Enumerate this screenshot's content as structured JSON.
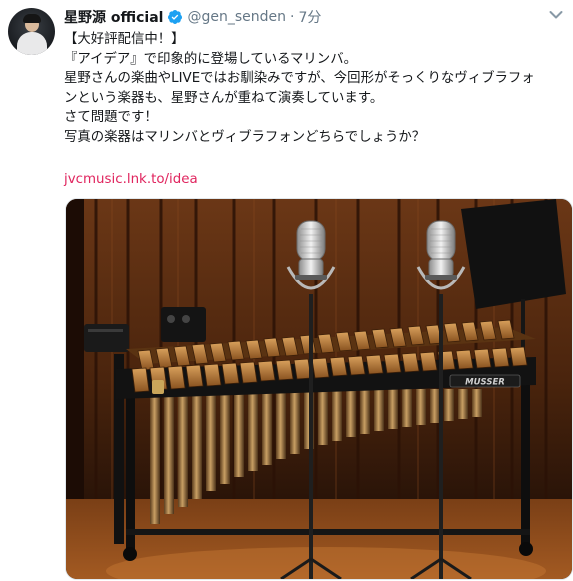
{
  "tweet": {
    "display_name": "星野源 official",
    "handle": "@gen_senden",
    "separator": "·",
    "time": "7分",
    "body_lines": [
      "【大好評配信中！】",
      "『アイデア』で印象的に登場しているマリンバ。",
      "星野さんの楽曲やLIVEではお馴染みですが、今回形がそっくりなヴィブラフォ",
      "ンという楽器も、星野さんが重ねて演奏しています。",
      "さて問題です！",
      "写真の楽器はマリンバとヴィブラフォンどちらでしょうか？"
    ],
    "link_text": "jvcmusic.lnk.to/idea",
    "photo_brand_text": "MUSSER"
  },
  "colors": {
    "verified": "#1da1f2",
    "link": "#e0245e",
    "secondary_text": "#657786"
  },
  "icons": {
    "verified": "verified-badge-icon",
    "menu": "chevron-down-icon"
  }
}
